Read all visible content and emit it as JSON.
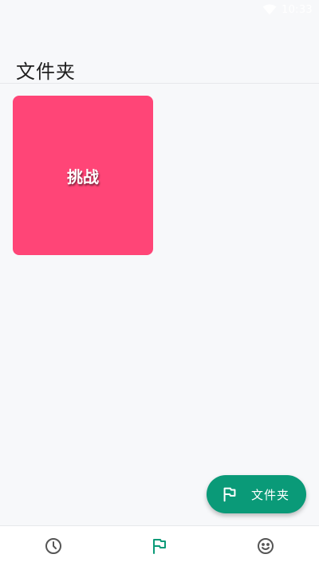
{
  "status_bar": {
    "time": "10:33",
    "wifi_icon": "wifi-icon"
  },
  "header": {
    "title": "文件夹"
  },
  "folders": [
    {
      "label": "挑战",
      "color": "#ff4577"
    }
  ],
  "fab": {
    "label": "文件夹",
    "icon": "flag-icon",
    "color": "#0a9a78"
  },
  "bottom_nav": {
    "items": [
      {
        "name": "history",
        "icon": "clock-icon",
        "active": false
      },
      {
        "name": "folders",
        "icon": "flag-icon",
        "active": true
      },
      {
        "name": "profile",
        "icon": "smiley-icon",
        "active": false
      }
    ],
    "active_color": "#0a9a78",
    "inactive_color": "#555555"
  }
}
